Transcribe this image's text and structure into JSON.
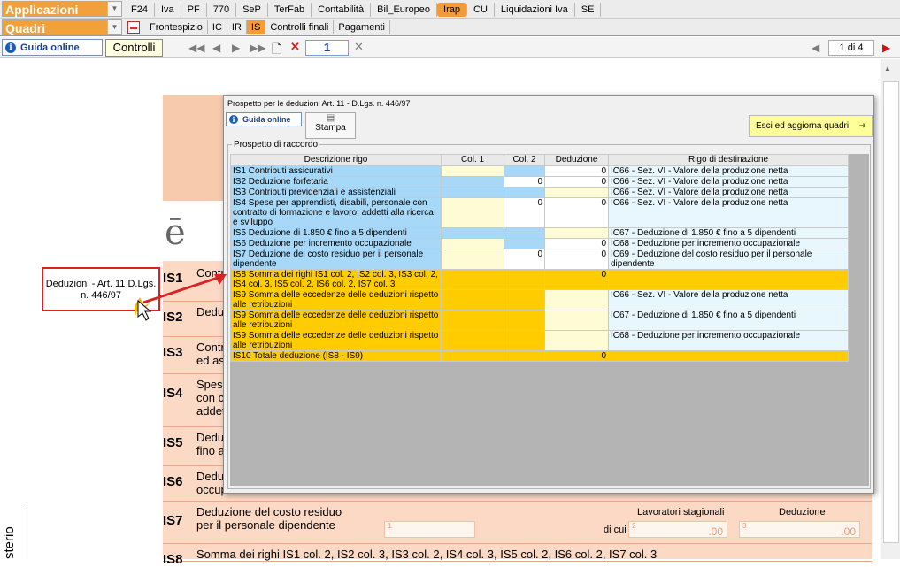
{
  "topbar": {
    "applicazioni": "Applicazioni",
    "quadri": "Quadri",
    "tabs": [
      "F24",
      "Iva",
      "PF",
      "770",
      "SeP",
      "TerFab",
      "Contabilità",
      "Bil_Europeo",
      "Irap",
      "CU",
      "Liquidazioni Iva",
      "SE"
    ],
    "subtabs": [
      "Frontespizio",
      "IC",
      "IR",
      "IS",
      "Controlli finali",
      "Pagamenti"
    ],
    "active_tab": "Irap",
    "active_subtab": "IS"
  },
  "toolbar": {
    "guida": "Guida online",
    "controlli": "Controlli",
    "page": "1",
    "page_of": "1 di 4"
  },
  "form": {
    "rows": [
      {
        "code": "IS1",
        "text": "Contr"
      },
      {
        "code": "IS2",
        "text": "Deduz"
      },
      {
        "code": "IS3",
        "text": "Contri\ned assi"
      },
      {
        "code": "IS4",
        "text": "Spese\ncon co\naddet"
      },
      {
        "code": "IS5",
        "text": "Deduz\nfino a"
      },
      {
        "code": "IS6",
        "text": "Deduz\noccup"
      },
      {
        "code": "IS7",
        "text": "Deduzione del costo residuo\nper il personale dipendente"
      },
      {
        "code": "IS8",
        "text": "Somma dei righi IS1 col. 2, IS2 col. 3, IS3 col. 2, IS4 col. 3, IS5 col. 2, IS6 col. 2, IS7 col. 3"
      }
    ],
    "lavoratori": "Lavoratori stagionali",
    "deduzione": "Deduzione",
    "di_cui": "di cui",
    "field1": "1",
    "field2": "2",
    "field3": "3",
    "zero": ".00",
    "side": "sterio"
  },
  "callout": "Deduzioni - Art. 11 D.Lgs. n. 446/97",
  "dialog": {
    "title": "Prospetto per le deduzioni Art. 11 - D.Lgs. n. 446/97",
    "guida": "Guida online",
    "stampa": "Stampa",
    "esci": "Esci ed aggiorna quadri",
    "group": "Prospetto di raccordo",
    "headers": [
      "Descrizione rigo",
      "Col. 1",
      "Col. 2",
      "Deduzione",
      "Rigo di destinazione"
    ],
    "rows": [
      {
        "desc": "IS1 Contributi assicurativi",
        "c1": "",
        "c2": "",
        "ded": "0",
        "dest": "IC66 - Sez. VI - Valore della produzione netta",
        "style": "blue",
        "c1s": "cream",
        "c2s": "blue"
      },
      {
        "desc": "IS2 Deduzione forfetaria",
        "c1": "",
        "c2": "0",
        "ded": "0",
        "dest": "IC66 - Sez. VI - Valore della produzione netta",
        "style": "blue",
        "c1s": "blue",
        "c2s": "white"
      },
      {
        "desc": "IS3 Contributi previdenziali e assistenziali",
        "c1": "",
        "c2": "",
        "ded": "",
        "dest": "IC66 - Sez. VI - Valore della produzione netta",
        "style": "blue",
        "c1s": "blue",
        "c2s": "blue"
      },
      {
        "desc": "IS4 Spese per apprendisti, disabili, personale con contratto di formazione e lavoro, addetti alla ricerca e sviluppo",
        "c1": "",
        "c2": "0",
        "ded": "0",
        "dest": "IC66 - Sez. VI - Valore della produzione netta",
        "style": "blue",
        "c1s": "cream",
        "c2s": "white"
      },
      {
        "desc": "IS5 Deduzione di 1.850 € fino a 5 dipendenti",
        "c1": "",
        "c2": "",
        "ded": "",
        "dest": "IC67 - Deduzione di 1.850 € fino a 5 dipendenti",
        "style": "blue",
        "c1s": "blue",
        "c2s": "blue"
      },
      {
        "desc": "IS6 Deduzione per incremento occupazionale",
        "c1": "",
        "c2": "",
        "ded": "0",
        "dest": "IC68 - Deduzione per incremento occupazionale",
        "style": "blue",
        "c1s": "cream",
        "c2s": "blue"
      },
      {
        "desc": "IS7 Deduzione del costo residuo per il personale dipendente",
        "c1": "",
        "c2": "0",
        "ded": "0",
        "dest": "IC69 - Deduzione del costo residuo per il personale dipendente",
        "style": "blue",
        "c1s": "cream",
        "c2s": "white"
      },
      {
        "desc": "IS8 Somma dei righi IS1 col. 2, IS2 col. 3, IS3 col. 2, IS4 col. 3, IS5 col. 2, IS6 col. 2, IS7 col. 3",
        "c1": "",
        "c2": "",
        "ded": "0",
        "dest": "",
        "style": "orange",
        "c1s": "orange",
        "c2s": "orange"
      },
      {
        "desc": "IS9 Somma delle eccedenze delle deduzioni rispetto alle retribuzioni",
        "c1": "",
        "c2": "",
        "ded": "",
        "dest": "IC66 - Sez. VI - Valore della produzione netta",
        "style": "orange",
        "c1s": "orange",
        "c2s": "orange"
      },
      {
        "desc": "IS9 Somma delle eccedenze delle deduzioni rispetto alle retribuzioni",
        "c1": "",
        "c2": "",
        "ded": "",
        "dest": "IC67 - Deduzione di 1.850 € fino a 5 dipendenti",
        "style": "orange",
        "c1s": "orange",
        "c2s": "orange"
      },
      {
        "desc": "IS9 Somma delle eccedenze delle deduzioni rispetto alle retribuzioni",
        "c1": "",
        "c2": "",
        "ded": "",
        "dest": "IC68 - Deduzione per incremento occupazionale",
        "style": "orange",
        "c1s": "orange",
        "c2s": "orange"
      },
      {
        "desc": "IS10 Totale deduzione (IS8 - IS9)",
        "c1": "",
        "c2": "",
        "ded": "0",
        "dest": "",
        "style": "orange",
        "c1s": "orange",
        "c2s": "orange"
      }
    ]
  }
}
